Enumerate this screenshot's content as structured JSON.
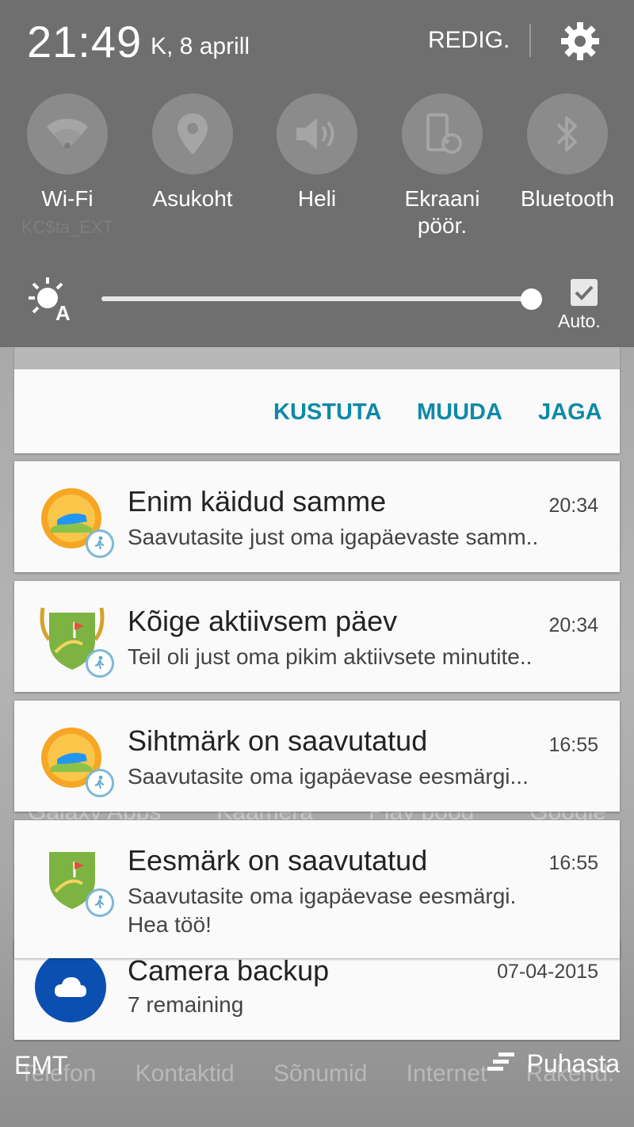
{
  "status": {
    "time": "21:49",
    "date": "K, 8 aprill",
    "edit_label": "REDIG."
  },
  "toggles": [
    {
      "label": "Wi-Fi",
      "sub": "KC$ta_EXT",
      "icon": "wifi-icon"
    },
    {
      "label": "Asukoht",
      "icon": "location-icon"
    },
    {
      "label": "Heli",
      "icon": "volume-icon"
    },
    {
      "label": "Ekraani pöör.",
      "icon": "screen-rotation-icon"
    },
    {
      "label": "Bluetooth",
      "icon": "bluetooth-icon"
    }
  ],
  "brightness": {
    "level": 0.99,
    "auto_label": "Auto.",
    "auto_checked": true
  },
  "actions": {
    "delete": "KUSTUTA",
    "edit": "MUUDA",
    "share": "JAGA"
  },
  "notifications": [
    {
      "title": "Enim käidud samme",
      "time": "20:34",
      "text": "Saavutasite just oma igapäevaste samm..",
      "icon": "sun-shoe-badge-icon"
    },
    {
      "title": "Kõige aktiivsem päev",
      "time": "20:34",
      "text": "Teil oli just oma pikim aktiivsete minutite..",
      "icon": "shield-flag-badge-icon"
    },
    {
      "title": "Sihtmärk on saavutatud",
      "time": "16:55",
      "text": "Saavutasite oma igapäevase eesmärgi...",
      "icon": "sun-shoe-badge-icon"
    },
    {
      "title": "Eesmärk on saavutatud",
      "time": "16:55",
      "text": "Saavutasite oma igapäevase eesmärgi.",
      "text2": "Hea töö!",
      "icon": "shield-flag-badge-icon"
    },
    {
      "title": "Camera backup",
      "time": "07-04-2015",
      "text": "7 remaining",
      "icon": "cloud-icon"
    }
  ],
  "footer": {
    "carrier": "EMT",
    "clear_label": "Puhasta"
  },
  "background_apps": {
    "row1": [
      "Galaxy Apps",
      "Kaamera",
      "Play pood",
      "Google"
    ],
    "row2": [
      "Telefon",
      "Kontaktid",
      "Sõnumid",
      "Internet",
      "Rakend."
    ]
  },
  "colors": {
    "panel": "#6f6f6f",
    "accent": "#0e8aa8",
    "cloud": "#0b4fb1"
  }
}
